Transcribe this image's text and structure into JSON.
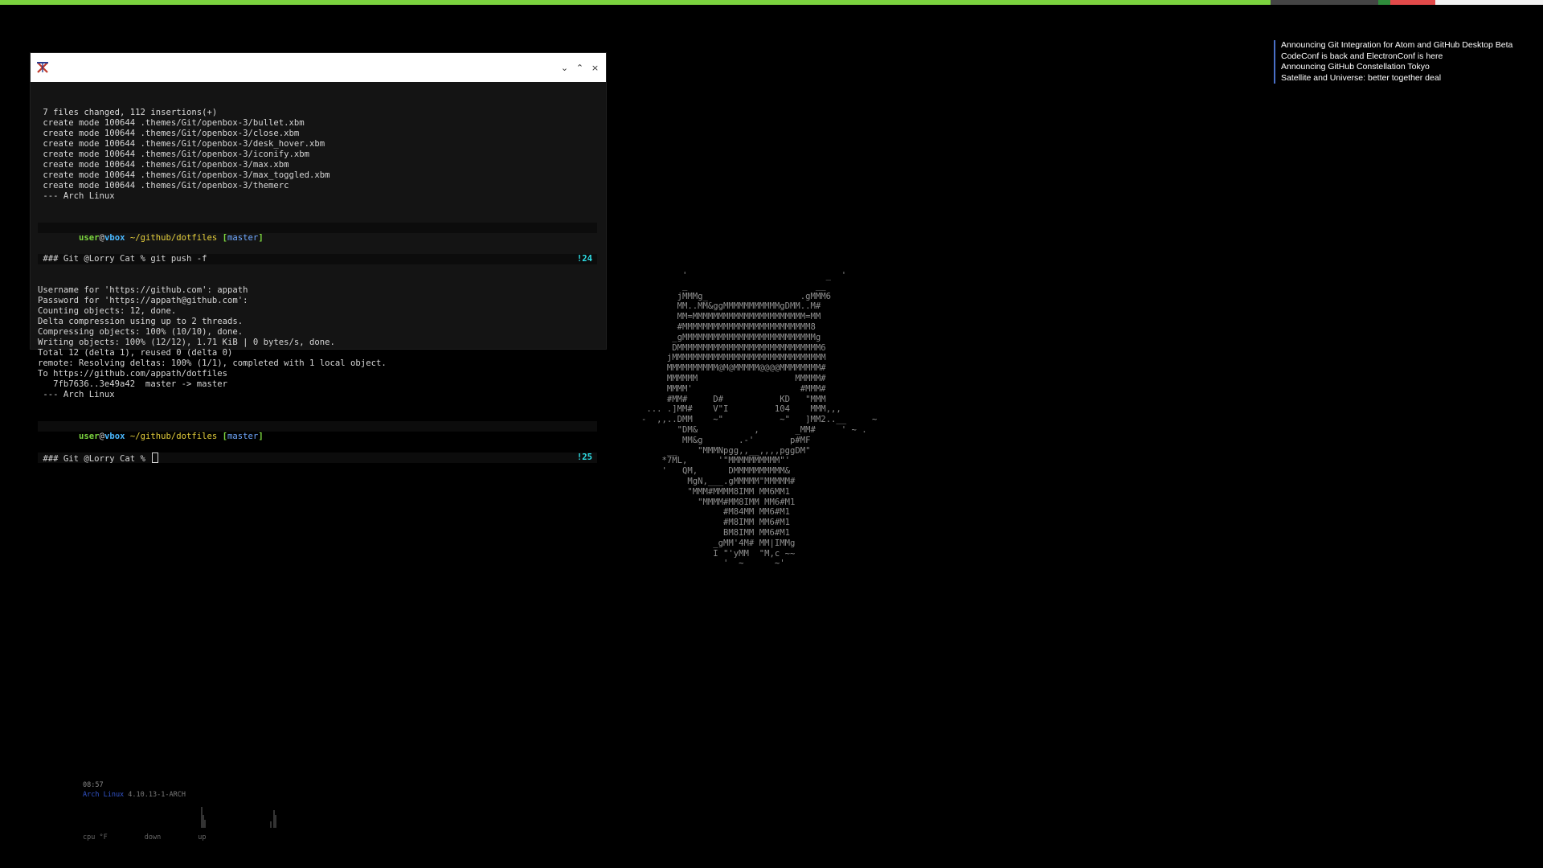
{
  "topbar": {
    "segments": [
      {
        "color": "#7bd23f",
        "width": 1581
      },
      {
        "color": "#444444",
        "width": 134
      },
      {
        "color": "#2e8b3a",
        "width": 15
      },
      {
        "color": "#e24a4a",
        "width": 56
      },
      {
        "color": "#f2f2f2",
        "width": 134
      }
    ]
  },
  "terminal": {
    "controls": {
      "minimize": "⌄",
      "maximize": "⌃",
      "close": "×"
    },
    "output_top": [
      " 7 files changed, 112 insertions(+)",
      " create mode 100644 .themes/Git/openbox-3/bullet.xbm",
      " create mode 100644 .themes/Git/openbox-3/close.xbm",
      " create mode 100644 .themes/Git/openbox-3/desk_hover.xbm",
      " create mode 100644 .themes/Git/openbox-3/iconify.xbm",
      " create mode 100644 .themes/Git/openbox-3/max.xbm",
      " create mode 100644 .themes/Git/openbox-3/max_toggled.xbm",
      " create mode 100644 .themes/Git/openbox-3/themerc",
      " --- Arch Linux"
    ],
    "prompt1": {
      "user": "user",
      "at": "@",
      "host": "vbox",
      "path": " ~/github/dotfiles ",
      "lbracket": "[",
      "branch": "master",
      "rbracket": "]",
      "command": " ### Git @Lorry Cat % git push -f",
      "counter": "!24"
    },
    "output_mid": [
      "Username for 'https://github.com': appath",
      "Password for 'https://appath@github.com':",
      "Counting objects: 12, done.",
      "Delta compression using up to 2 threads.",
      "Compressing objects: 100% (10/10), done.",
      "Writing objects: 100% (12/12), 1.71 KiB | 0 bytes/s, done.",
      "Total 12 (delta 1), reused 0 (delta 0)",
      "remote: Resolving deltas: 100% (1/1), completed with 1 local object.",
      "To https://github.com/appath/dotfiles",
      "   7fb7636..3e49a42  master -> master",
      " --- Arch Linux"
    ],
    "prompt2": {
      "user": "user",
      "at": "@",
      "host": "vbox",
      "path": " ~/github/dotfiles ",
      "lbracket": "[",
      "branch": "master",
      "rbracket": "]",
      "command": " ### Git @Lorry Cat % ",
      "counter": "!25"
    }
  },
  "news": [
    "Announcing Git Integration for Atom and GitHub Desktop Beta",
    "CodeConf is back and ElectronConf is here",
    "Announcing GitHub Constellation Tokyo",
    "Satellite and Universe: better together deal"
  ],
  "ascii_art": "        '                           _  '\n        _                         __\n       jMMMg_                  .gMMM6\n       MM..MM&ggMMMMMMMMMMMgDMM..M#\n       MM=MMMMMMMMMMMMMMMMMMMMMM=MM\n       #MMMMMMMMMMMMMMMMMMMMMMMMM8\n      _gMMMMMMMMMMMMMMMMMMMMMMMMMMg\n      DMMMMMMMMMMMMMMMMMMMMMMMMMMMM6\n     jMMMMMMMMMMMMMMMMMMMMMMMMMMMMMM\n     MMMMMMMMMM@M@MMMMM@@@@MMMMMMMM#\n     MMMMMM                   MMMMM#\n     MMMM'                     #MMM#\n     #MM#     D#           KD   \"MMM\n ... .]MM#    V\"I         104    MMM,,,\n-  ,,..DMM    ~\"           ~\"   ]MM2..__     ~\n       \"DM&           ,       _MM#     ' ~ .\n        MM&g       .-'       p#MF\n     __    \"MMMNpgg,,__,,,,pggDM\"\n    *7ML,      '\"MMMMMMMMMM\"'\n    '   QM,      DMMMMMMMMMM&\n         MgN,___.gMMMMM\"MMMMM#\n         \"MMM#MMMM8IMM MM6MM1\n           \"MMMM#MM8IMM MM6#M1\n                #M84MM MM6#M1\n                #M8IMM MM6#M1\n                BM8IMM MM6#M1\n              _gMM'4M# MM|IMMg\n              I \"'yMM  \"M,c ~~\n                '  ~      ~'",
  "conky": {
    "time": "08:57",
    "distro": "Arch Linux",
    "kernel": " 4.10.13-1-ARCH",
    "labels": [
      "cpu  °F",
      "down",
      "up"
    ]
  }
}
